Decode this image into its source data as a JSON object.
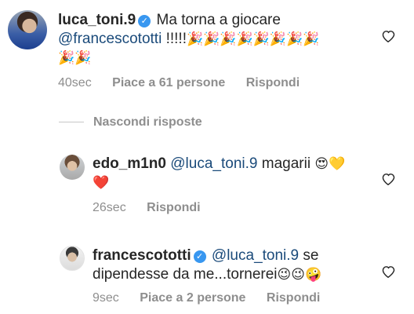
{
  "comments": [
    {
      "username": "luca_toni.9",
      "text_before_mention": "Ma torna a giocare",
      "mention": "@francescototti",
      "text_after_mention": "!!!!!",
      "emoji_line1": "🎉🎉🎉🎉🎉🎉🎉🎉",
      "emoji_line2": "🎉🎉",
      "time": "40sec",
      "likes": "Piace a 61 persone",
      "reply": "Rispondi",
      "verified": true
    },
    {
      "username": "edo_m1n0",
      "mention": "@luca_toni.9",
      "text": "magarii",
      "emoji_line1": "😍💛",
      "emoji_line2": "❤️",
      "time": "26sec",
      "reply": "Rispondi",
      "verified": false
    },
    {
      "username": "francescototti",
      "mention": "@luca_toni.9",
      "text_line1": "se",
      "text_line2": "dipendesse da me...tornerei",
      "emoji": "😉😉🤪",
      "time": "9sec",
      "likes": "Piace a 2 persone",
      "reply": "Rispondi",
      "verified": true
    }
  ],
  "hide_replies": "Nascondi risposte",
  "icons": {
    "verified": "verified-badge-icon",
    "like": "heart-outline-icon"
  },
  "colors": {
    "verified": "#3897f0",
    "mention": "#1a4a7a",
    "meta": "#8e8e8e"
  }
}
